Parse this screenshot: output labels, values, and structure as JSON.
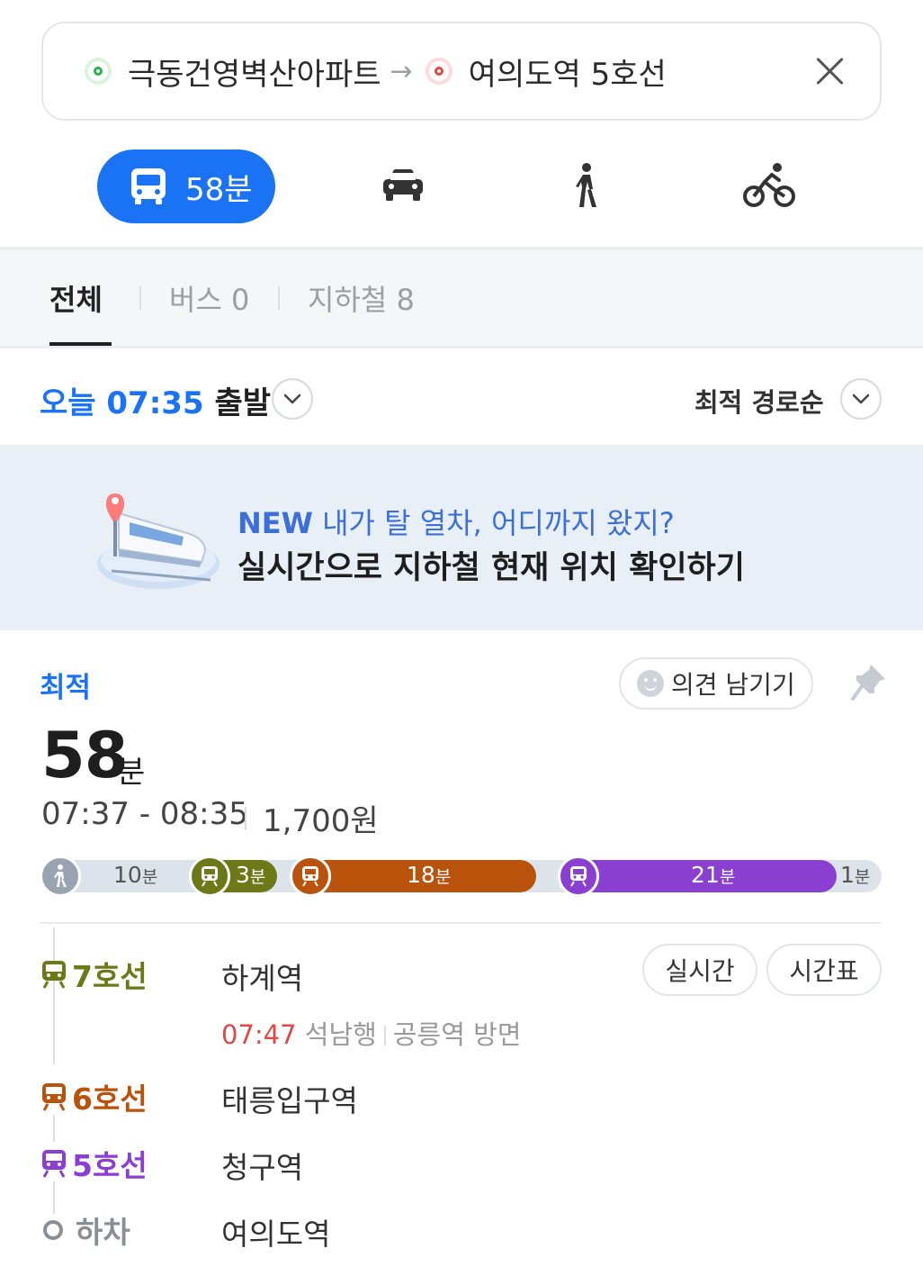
{
  "search": {
    "origin": "극동건영벽산아파트",
    "arrow": "→",
    "destination": "여의도역 5호선"
  },
  "modes": {
    "transit_time": "58분",
    "car": "car-icon",
    "walk": "walk-icon",
    "bike": "bike-icon"
  },
  "categories": {
    "all": "전체",
    "bus": "버스 0",
    "subway": "지하철 8"
  },
  "depart": {
    "prefix": "오늘 07:35",
    "suffix": "출발"
  },
  "sort": {
    "label": "최적 경로순"
  },
  "banner": {
    "new_tag": "NEW",
    "line1": "내가 탈 열차, 어디까지 왔지?",
    "line2": "실시간으로 지하철 현재 위치 확인하기"
  },
  "route": {
    "badge": "최적",
    "feedback": "의견 남기기",
    "total_time": "58",
    "total_unit": "분",
    "time_range": "07:37 - 08:35",
    "fare": "1,700원",
    "timeline": {
      "walk_start": {
        "num": "10",
        "unit": "분"
      },
      "line7": {
        "num": "3",
        "unit": "분"
      },
      "line6": {
        "num": "18",
        "unit": "분"
      },
      "line5": {
        "num": "21",
        "unit": "분"
      },
      "walk_end": {
        "num": "1",
        "unit": "분"
      }
    },
    "steps": [
      {
        "line": "7호선",
        "stop": "하계역",
        "color": "#6b7a17"
      },
      {
        "line": "6호선",
        "stop": "태릉입구역",
        "color": "#b9530c"
      },
      {
        "line": "5호선",
        "stop": "청구역",
        "color": "#8a3fd1"
      },
      {
        "line": "하차",
        "stop": "여의도역",
        "color": "#8a8f96"
      }
    ],
    "step1_detail": {
      "time": "07:47",
      "direction": "석남행",
      "toward": "공릉역 방면"
    },
    "realtime_button": "실시간",
    "timetable_button": "시간표"
  }
}
